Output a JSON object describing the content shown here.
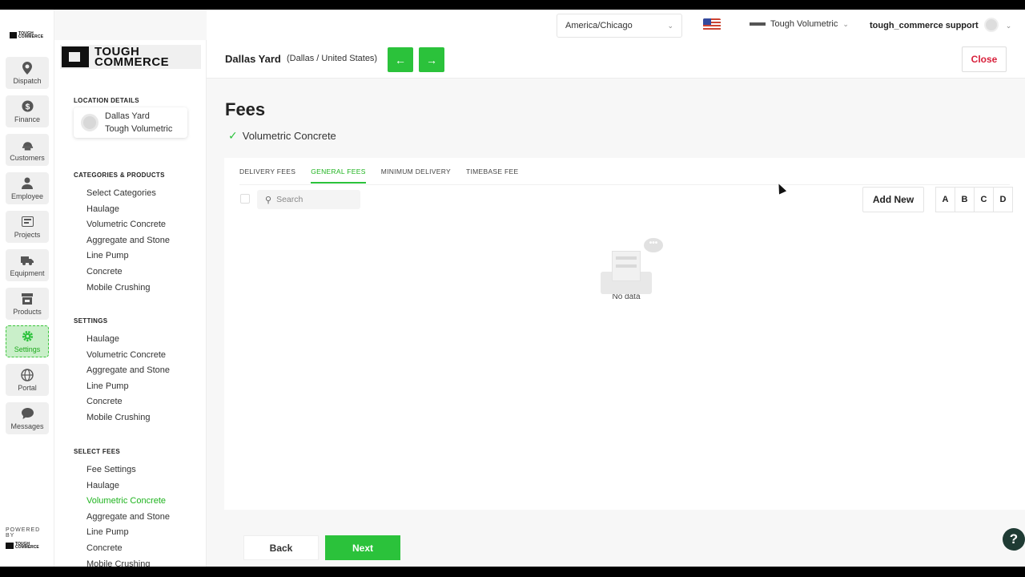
{
  "rail": {
    "items": [
      {
        "label": "Dispatch",
        "icon": "location-pin-icon"
      },
      {
        "label": "Finance",
        "icon": "dollar-icon"
      },
      {
        "label": "Customers",
        "icon": "hardhat-icon"
      },
      {
        "label": "Employee",
        "icon": "person-icon"
      },
      {
        "label": "Projects",
        "icon": "projects-icon"
      },
      {
        "label": "Equipment",
        "icon": "truck-icon"
      },
      {
        "label": "Products",
        "icon": "store-icon"
      },
      {
        "label": "Settings",
        "icon": "gear-icon",
        "active": true
      },
      {
        "label": "Portal",
        "icon": "globe-icon"
      },
      {
        "label": "Messages",
        "icon": "chat-icon"
      }
    ],
    "powered_by": "POWERED BY"
  },
  "brand": {
    "line1": "TOUGH",
    "line2": "COMMERCE"
  },
  "topbar": {
    "timezone": "America/Chicago",
    "company": "Tough Volumetric",
    "user": "tough_commerce support"
  },
  "location": {
    "name": "Dallas Yard",
    "sub": "(Dallas / United States)",
    "close_label": "Close"
  },
  "sidebar": {
    "location_details_heading": "LOCATION DETAILS",
    "card": {
      "name": "Dallas Yard",
      "company": "Tough Volumetric"
    },
    "categories_heading": "CATEGORIES & PRODUCTS",
    "categories": [
      "Select Categories",
      "Haulage",
      "Volumetric Concrete",
      "Aggregate and Stone",
      "Line Pump",
      "Concrete",
      "Mobile Crushing"
    ],
    "settings_heading": "SETTINGS",
    "settings": [
      "Haulage",
      "Volumetric Concrete",
      "Aggregate and Stone",
      "Line Pump",
      "Concrete",
      "Mobile Crushing"
    ],
    "fees_heading": "SELECT FEES",
    "fees": [
      "Fee Settings",
      "Haulage",
      "Volumetric Concrete",
      "Aggregate and Stone",
      "Line Pump",
      "Concrete",
      "Mobile Crushing"
    ],
    "fees_active_index": 2
  },
  "main": {
    "title": "Fees",
    "product": "Volumetric Concrete",
    "tabs": [
      "DELIVERY FEES",
      "GENERAL FEES",
      "MINIMUM DELIVERY",
      "TIMEBASE FEE"
    ],
    "active_tab_index": 1,
    "search_placeholder": "Search",
    "add_new_label": "Add New",
    "letters": [
      "A",
      "B",
      "C",
      "D"
    ],
    "empty_label": "No data"
  },
  "footer": {
    "back_label": "Back",
    "next_label": "Next",
    "help_label": "?"
  },
  "colors": {
    "accent": "#2bc23b",
    "danger": "#d8203b"
  }
}
